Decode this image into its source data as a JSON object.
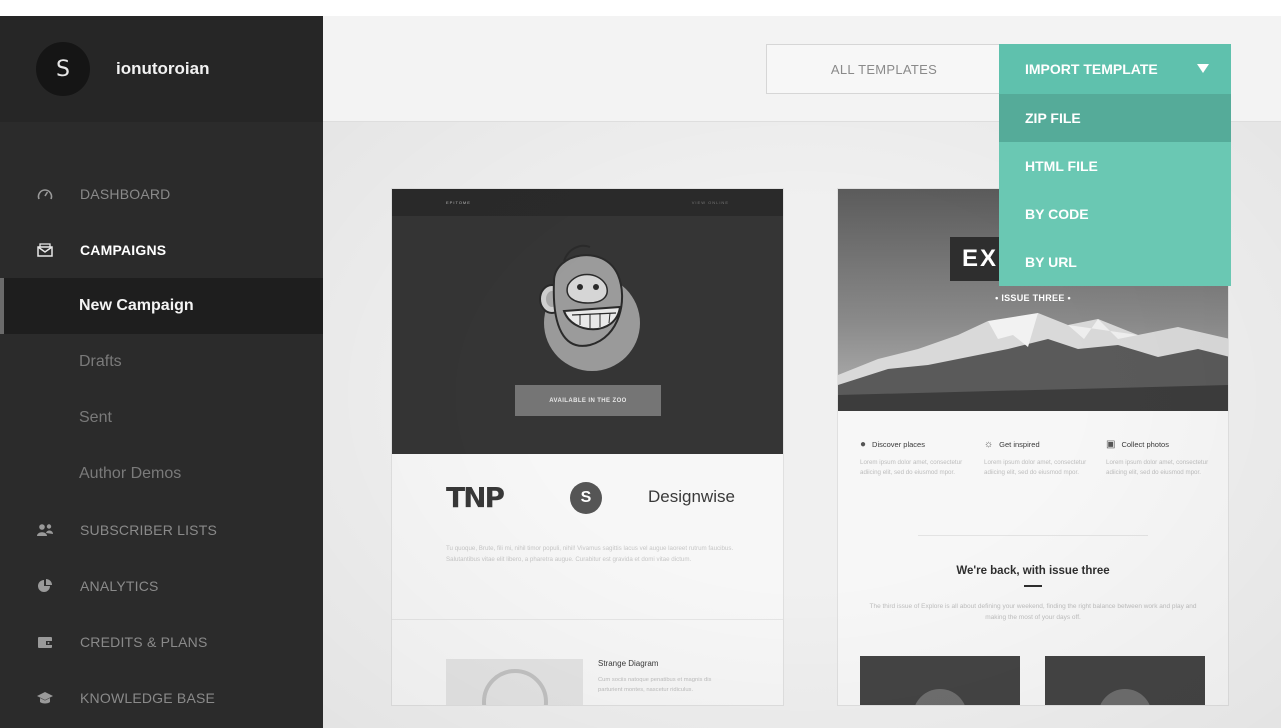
{
  "sidebar": {
    "avatar_letter": "S",
    "username": "ionutoroian",
    "nav": [
      {
        "label": "DASHBOARD",
        "icon": "gauge-icon"
      },
      {
        "label": "CAMPAIGNS",
        "icon": "envelope-icon"
      },
      {
        "label": "SUBSCRIBER LISTS",
        "icon": "users-icon"
      },
      {
        "label": "ANALYTICS",
        "icon": "pie-chart-icon"
      },
      {
        "label": "CREDITS & PLANS",
        "icon": "wallet-icon"
      },
      {
        "label": "KNOWLEDGE BASE",
        "icon": "graduation-cap-icon"
      }
    ],
    "campaign_subitems": [
      "New Campaign",
      "Drafts",
      "Sent",
      "Author Demos"
    ],
    "active_subitem": "New Campaign"
  },
  "toolbar": {
    "all_templates_label": "ALL TEMPLATES",
    "import_label": "IMPORT TEMPLATE",
    "dropdown": [
      "ZIP FILE",
      "HTML FILE",
      "BY CODE",
      "BY URL"
    ],
    "hovered": "ZIP FILE"
  },
  "colors": {
    "accent": "#5fc1ad",
    "dropdown": "#6ac8b3",
    "dropdown_hover": "#55ab99",
    "sidebar": "#2b2b2b"
  },
  "template1": {
    "brand": "EPITOME",
    "view_online": "VIEW ONLINE",
    "cta": "AVAILABLE IN THE ZOO",
    "logo_tnp": "TNP",
    "logo_s": "S",
    "logo_designwise": "Designwise",
    "paragraph": "Tu quoque, Brute, fili mi, nihil timor populi, nihil! Vivamus sagittis lacus vel augue laoreet rutrum faucibus. Salutantibus vitae elit libero, a pharetra augue. Curabitur est gravida et domi vitae dictum.",
    "diagram_title": "Strange Diagram",
    "diagram_text": "Cum sociis natoque penatibus et magnis dis parturient montes, nascetur ridiculus."
  },
  "template2": {
    "logo": "EX",
    "issue": "• ISSUE THREE •",
    "features": [
      {
        "title": "Discover places",
        "icon": "map-pin-icon",
        "text": "Lorem ipsum dolor amet, consectetur adiicing elit, sed do eiusmod mpor."
      },
      {
        "title": "Get inspired",
        "icon": "lightbulb-icon",
        "text": "Lorem ipsum dolor amet, consectetur adiicing elit, sed do eiusmod mpor."
      },
      {
        "title": "Collect photos",
        "icon": "image-icon",
        "text": "Lorem ipsum dolor amet, consectetur adiicing elit, sed do eiusmod mpor."
      }
    ],
    "headline": "We're back, with issue three",
    "body": "The third issue of Explore is all about defining your weekend, finding the right balance between work and play and making the most of your days off."
  }
}
